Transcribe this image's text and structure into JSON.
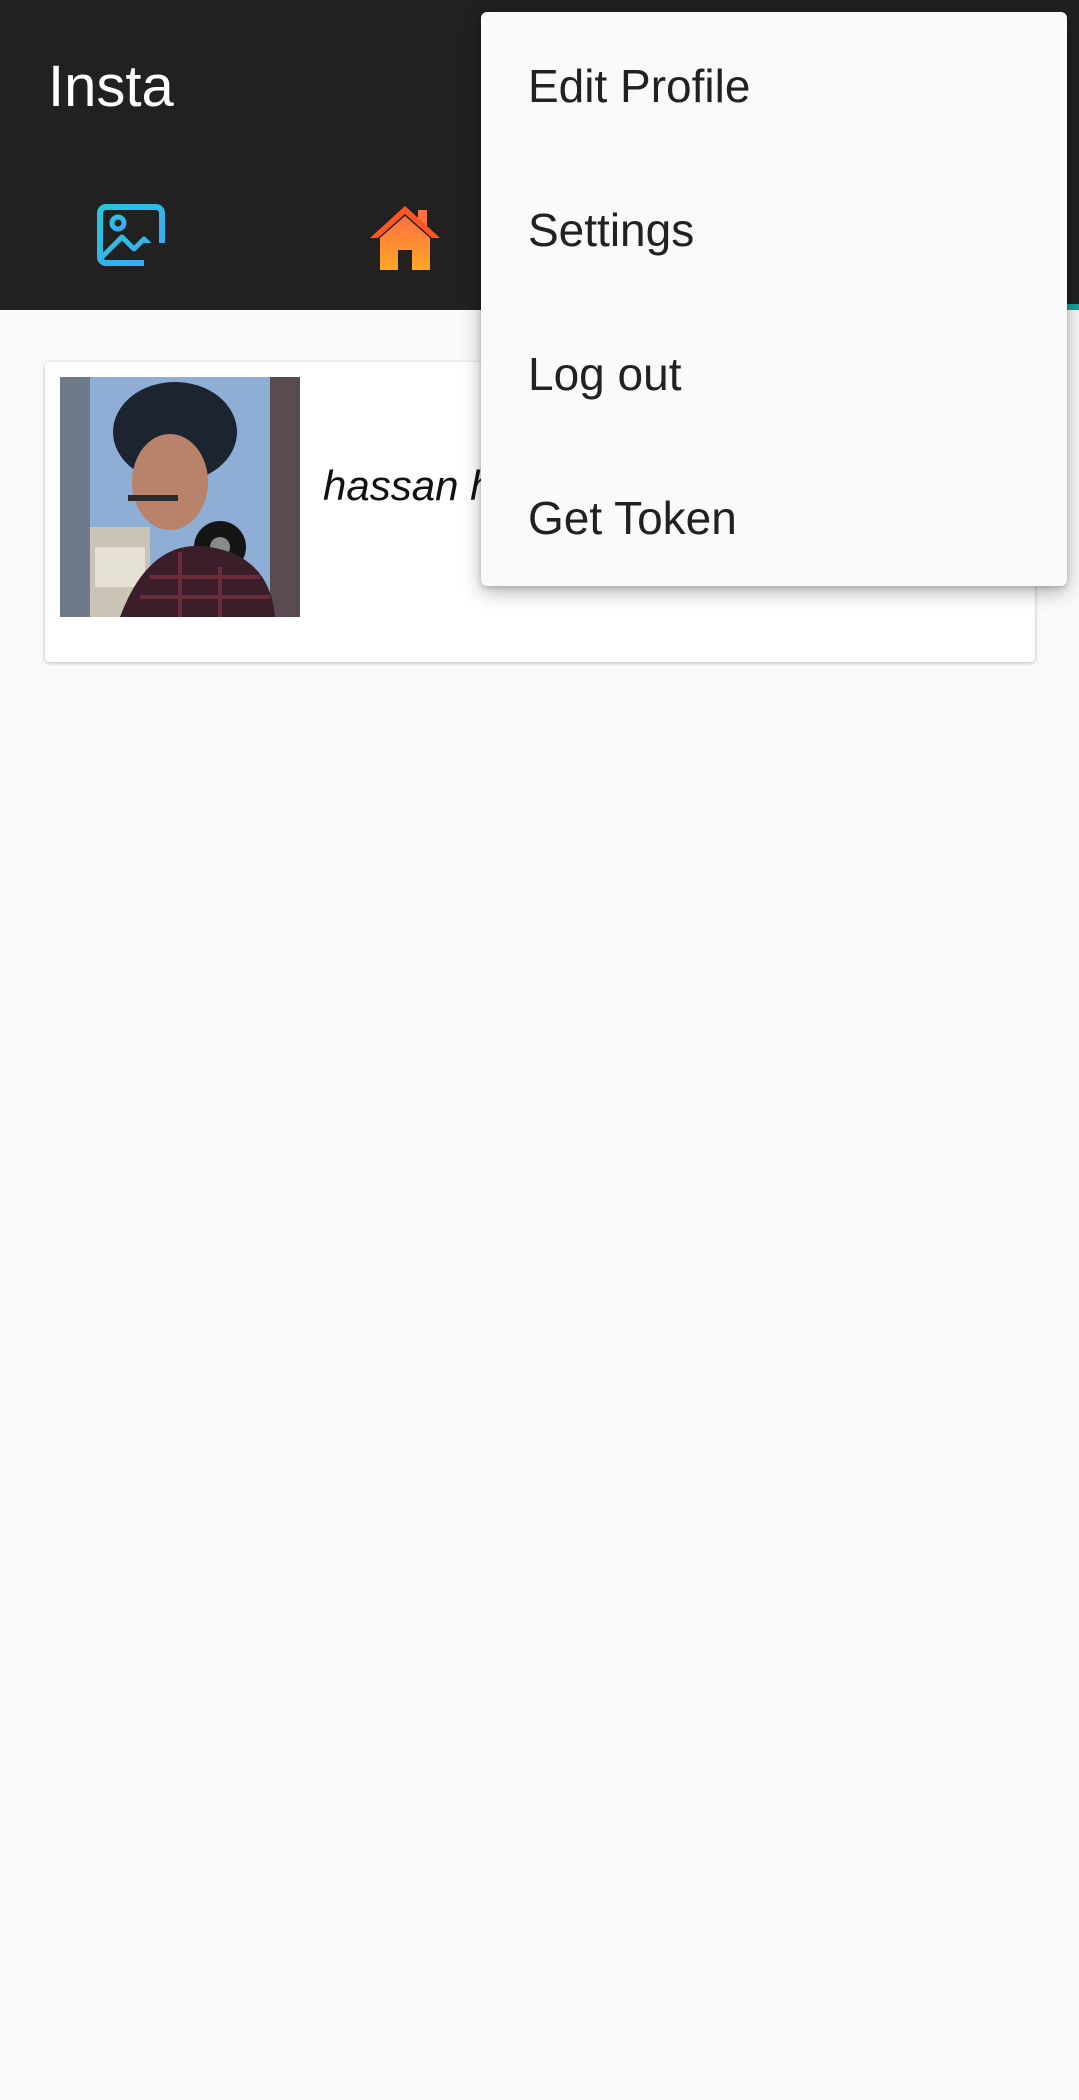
{
  "app": {
    "title": "Insta"
  },
  "tabs": [
    {
      "icon": "add-photo-icon",
      "color": "#29b6f6"
    },
    {
      "icon": "home-icon",
      "color": "#ff7043"
    }
  ],
  "accent_color": "#1aa39a",
  "profile": {
    "username": "hassan h"
  },
  "menu": {
    "items": [
      {
        "label": "Edit Profile"
      },
      {
        "label": "Settings"
      },
      {
        "label": "Log out"
      },
      {
        "label": "Get Token"
      }
    ]
  }
}
